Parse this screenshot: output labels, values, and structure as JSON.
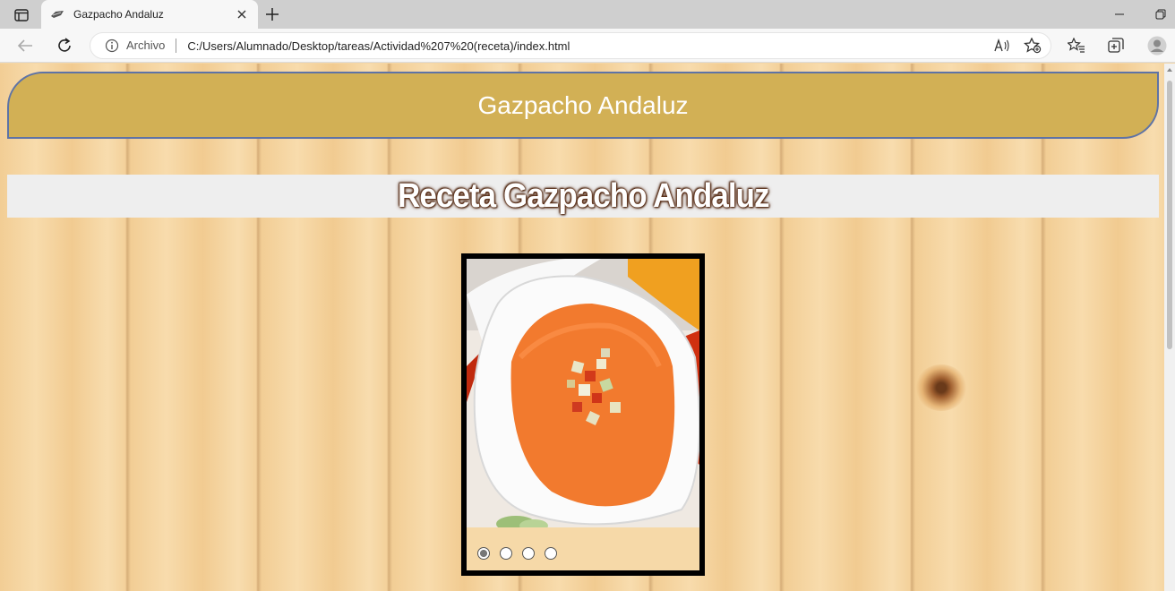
{
  "browser": {
    "tab_title": "Gazpacho Andaluz",
    "address_scheme": "Archivo",
    "address_url": "C:/Users/Alumnado/Desktop/tareas/Actividad%207%20(receta)/index.html"
  },
  "page": {
    "header_title": "Gazpacho Andaluz",
    "main_heading": "Receta Gazpacho Andaluz",
    "slider": {
      "image_alt": "gazpacho-bowl-photo",
      "slide_count": 4,
      "active_slide": 1
    }
  },
  "colors": {
    "header_bg": "#d2b055",
    "header_border": "#5e73a6",
    "title_band_bg": "#eeeeee",
    "slider_frame": "#000000"
  }
}
